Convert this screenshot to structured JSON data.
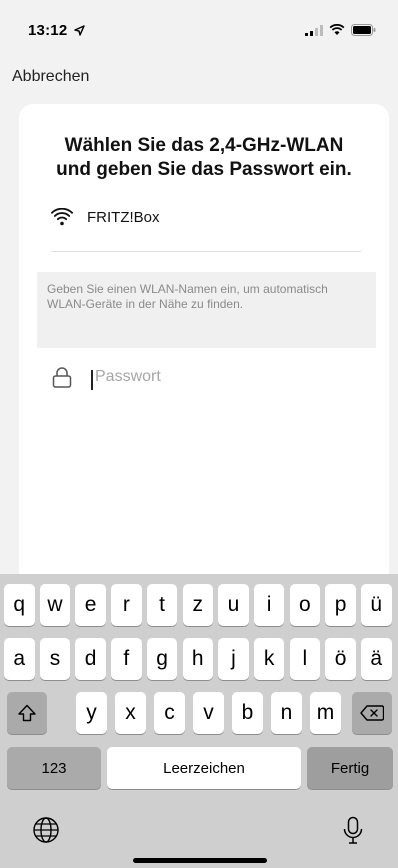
{
  "status": {
    "time": "13:12"
  },
  "nav": {
    "cancel_label": "Abbrechen"
  },
  "card": {
    "title_line1": "Wählen Sie das 2,4-GHz-WLAN",
    "title_line2": "und geben Sie das Passwort ein.",
    "network_name": "FRITZ!Box",
    "hint_text": "Geben Sie einen WLAN-Namen ein, um automatisch WLAN-Geräte in der Nähe zu finden.",
    "password_placeholder": "Passwort",
    "password_value": ""
  },
  "keyboard": {
    "row1": [
      "q",
      "w",
      "e",
      "r",
      "t",
      "z",
      "u",
      "i",
      "o",
      "p",
      "ü"
    ],
    "row2": [
      "a",
      "s",
      "d",
      "f",
      "g",
      "h",
      "j",
      "k",
      "l",
      "ö",
      "ä"
    ],
    "row3": [
      "y",
      "x",
      "c",
      "v",
      "b",
      "n",
      "m"
    ],
    "numbers_label": "123",
    "space_label": "Leerzeichen",
    "done_label": "Fertig"
  },
  "icons": {
    "shift": "shift-icon",
    "backspace": "backspace-icon",
    "globe": "globe-icon",
    "mic": "microphone-icon",
    "wifi": "wifi-icon",
    "lock": "lock-icon"
  }
}
